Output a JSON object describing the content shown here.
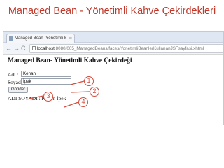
{
  "slide": {
    "title": "Managed Bean - Yönetimli Kahve Çekirdekleri"
  },
  "browser": {
    "tab_title": "Managed Bean- Yönetimli k",
    "tab_close": "×",
    "nav": {
      "back": "←",
      "forward": "→",
      "reload": "C"
    },
    "url_host": "localhost",
    "url_path": ":8080/005_ManagedBeans/faces/YonetimliBeanlerKullananJSFsayfasi.xhtml"
  },
  "page": {
    "heading": "Managed Bean- Yönetimli Kahve Çekirdeği",
    "ad_label": "Adı :",
    "ad_value": "Kenan",
    "soyad_label": "Soyadı",
    "soyad_value": "İpek",
    "submit_label": "Gönder",
    "result_text": "ADI SOYADI : Kenan İpek"
  },
  "annotations": [
    "1",
    "2",
    "3",
    "4"
  ],
  "colors": {
    "accent": "#d54b3d",
    "title": "#c0392b"
  }
}
